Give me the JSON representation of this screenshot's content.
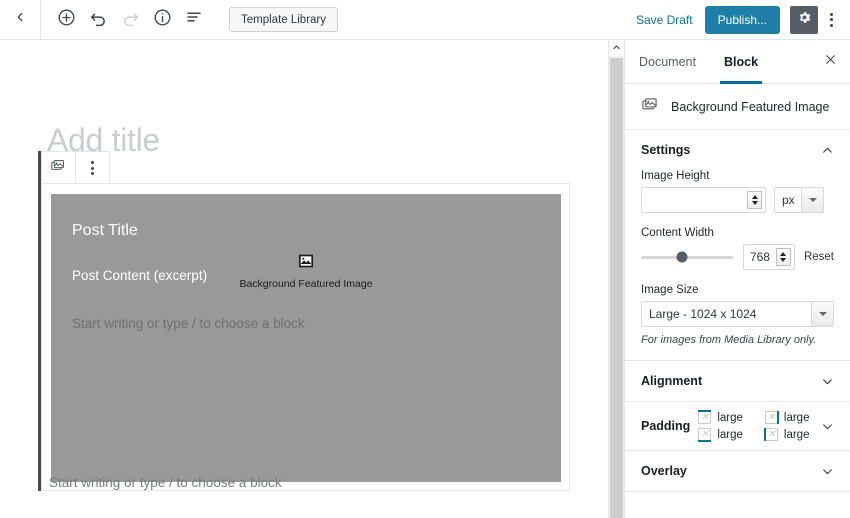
{
  "topbar": {
    "back_icon": "chevron-left-icon",
    "add_icon": "plus-circle-icon",
    "undo_icon": "undo-icon",
    "redo_icon": "redo-icon",
    "info_icon": "info-circle-icon",
    "list_view_icon": "list-view-icon",
    "template_library_label": "Template Library",
    "save_draft_label": "Save Draft",
    "publish_label": "Publish...",
    "settings_gear_icon": "gear-icon",
    "more_menu_icon": "more-vertical-icon"
  },
  "canvas": {
    "title_placeholder": "Add title",
    "block_toolbar": {
      "block_type_icon": "image-stack-icon",
      "more_options_icon": "more-vertical-icon"
    },
    "block_preview": {
      "post_title": "Post Title",
      "post_content": "Post Content (excerpt)",
      "inner_placeholder": "Start writing or type / to choose a block",
      "center_icon": "image-placeholder-icon",
      "center_label": "Background Featured Image"
    },
    "bottom_placeholder": "Start writing or type / to choose a block"
  },
  "scrollbar": {
    "up_arrow_icon": "chevron-up-icon"
  },
  "sidebar": {
    "tabs": [
      {
        "label": "Document",
        "active": false
      },
      {
        "label": "Block",
        "active": true
      }
    ],
    "close_icon": "close-icon",
    "block_header": {
      "icon": "image-stack-icon",
      "label": "Background Featured Image"
    },
    "panels": [
      {
        "title": "Settings",
        "expanded": true
      },
      {
        "title": "Alignment",
        "expanded": false
      },
      {
        "title": "Overlay",
        "expanded": false
      }
    ],
    "settings": {
      "image_height": {
        "label": "Image Height",
        "value": "",
        "placeholder": "",
        "unit_value": "px"
      },
      "content_width": {
        "label": "Content Width",
        "value": "768",
        "reset_label": "Reset",
        "slider_percent": 45
      },
      "image_size": {
        "label": "Image Size",
        "value": "Large - 1024 x 1024",
        "help": "For images from Media Library only."
      }
    },
    "padding": {
      "label": "Padding",
      "items": [
        {
          "edge": "top",
          "value": "large"
        },
        {
          "edge": "right",
          "value": "large"
        },
        {
          "edge": "bottom",
          "value": "large"
        },
        {
          "edge": "left",
          "value": "large"
        }
      ]
    }
  },
  "colors": {
    "accent_blue": "#0071a1",
    "publish_blue": "#1e7fa8",
    "gear_dark": "#555d66",
    "block_gray": "#999999"
  }
}
